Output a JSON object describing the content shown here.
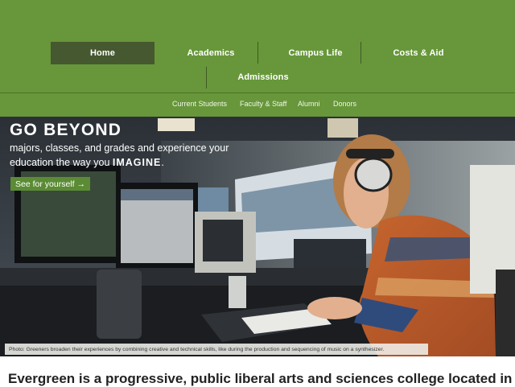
{
  "nav": {
    "items": [
      {
        "label": "Home",
        "active": true
      },
      {
        "label": "Academics",
        "active": false
      },
      {
        "label": "Campus Life",
        "active": false
      },
      {
        "label": "Costs & Aid",
        "active": false
      },
      {
        "label": "Admissions",
        "active": false
      }
    ]
  },
  "sub_nav": {
    "items": [
      "Current Students",
      "Faculty & Staff",
      "Alumni",
      "Donors"
    ]
  },
  "hero": {
    "headline": "GO BEYOND",
    "line1": "majors, classes, and grades and experience your",
    "line2_prefix": "education the way you ",
    "line2_emphasis": "IMAGINE",
    "line2_suffix": ".",
    "cta_label": "See for yourself →",
    "caption": "Photo: Greeners broaden their experiences by combining creative and technical skills, like during the production and sequencing of music on a synthesizer."
  },
  "intro": {
    "text": "Evergreen is a progressive, public liberal arts and sciences college located in"
  },
  "colors": {
    "band": "#67973a",
    "active_nav": "#46582f",
    "cta": "#5b8c35"
  }
}
